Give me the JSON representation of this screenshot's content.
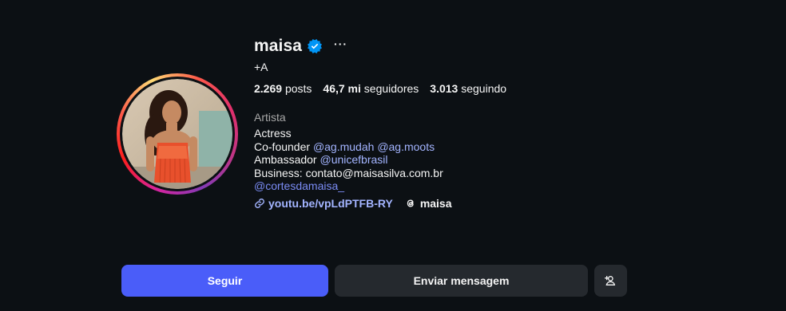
{
  "profile": {
    "username": "maisa",
    "more_label": "···",
    "full_name": "+A",
    "stats": {
      "posts_count": "2.269",
      "posts_label": "posts",
      "followers_count": "46,7 mi",
      "followers_label": "seguidores",
      "following_count": "3.013",
      "following_label": "seguindo"
    },
    "category": "Artista",
    "bio": {
      "line1": "Actress",
      "line2_prefix": "Co-founder",
      "line2_mention1": "@ag.mudah",
      "line2_mention2": "@ag.moots",
      "line3_prefix": "Ambassador",
      "line3_mention": "@unicefbrasil",
      "line4": "Business: contato@maisasilva.com.br",
      "line5_mention": "@cortesdamaisa_"
    },
    "link": "youtu.be/vpLdPTFB-RY",
    "threads_label": "maisa"
  },
  "actions": {
    "follow_label": "Seguir",
    "message_label": "Enviar mensagem"
  },
  "colors": {
    "background": "#0c1014",
    "follow_button": "#4a5df9",
    "secondary_button": "#25292e",
    "link": "#a3b4ff",
    "verified": "#0095f6"
  },
  "icons": {
    "verified": "verified-badge-icon",
    "more": "more-options-icon",
    "link": "link-icon",
    "threads": "threads-icon",
    "suggest": "add-person-icon"
  }
}
